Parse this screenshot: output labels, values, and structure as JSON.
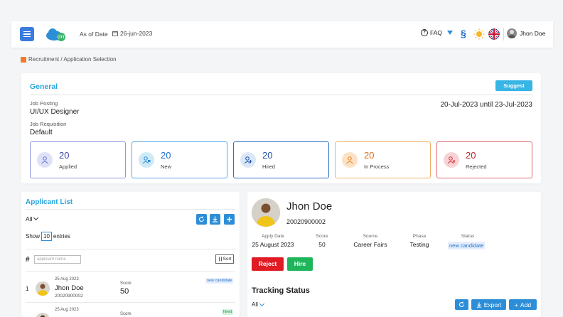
{
  "header": {
    "as_of_label": "As of Date",
    "as_of_date": "26-jun-2023",
    "faq_label": "FAQ",
    "user_name": "Jhon Doe",
    "logo_text": "OTT"
  },
  "breadcrumb": "Recruitment / Application Selection",
  "general": {
    "title": "General",
    "suggest_label": "Suggest",
    "job_posting_label": "Job Posting",
    "job_posting_value": "UI/UX Designer",
    "date_range": "20-Jul-2023 until 23-Jul-2023",
    "job_requisition_label": "Job Requisition",
    "job_requisition_value": "Default",
    "stats": [
      {
        "count": "20",
        "label": "Applied",
        "color": "#6e79d6"
      },
      {
        "count": "20",
        "label": "New",
        "color": "#2d8ed8"
      },
      {
        "count": "20",
        "label": "Hired",
        "color": "#1d4fa8"
      },
      {
        "count": "20",
        "label": "In Process",
        "color": "#e88a26"
      },
      {
        "count": "20",
        "label": "Rejected",
        "color": "#d9333d"
      }
    ]
  },
  "applicant_list": {
    "title": "Applicant List",
    "filter": "All",
    "show_label": "Show",
    "show_value": "10",
    "entries_label": "entries",
    "hash": "#",
    "search_placeholder": "applicant name",
    "sort_label": "Sort",
    "rows": [
      {
        "num": "1",
        "date": "25 Aug 2023",
        "name": "Jhon Doe",
        "id": "20020900002",
        "score_label": "Score",
        "score": "50",
        "badge": "new candidate"
      },
      {
        "num": "",
        "date": "25 Aug 2023",
        "name": "",
        "id": "",
        "score_label": "Score",
        "score": "",
        "badge": "hired"
      }
    ]
  },
  "detail": {
    "name": "Jhon Doe",
    "id": "20020900002",
    "columns": [
      {
        "label": "Apply Date",
        "value": "25 August 2023"
      },
      {
        "label": "Score",
        "value": "50"
      },
      {
        "label": "Source",
        "value": "Career Fairs"
      },
      {
        "label": "Phase",
        "value": "Testing"
      },
      {
        "label": "Status",
        "value": "new candidate"
      }
    ],
    "reject_label": "Reject",
    "hire_label": "Hire",
    "tracking_title": "Tracking Status",
    "tracking_filter": "All",
    "export_label": "Export",
    "add_label": "Add"
  }
}
